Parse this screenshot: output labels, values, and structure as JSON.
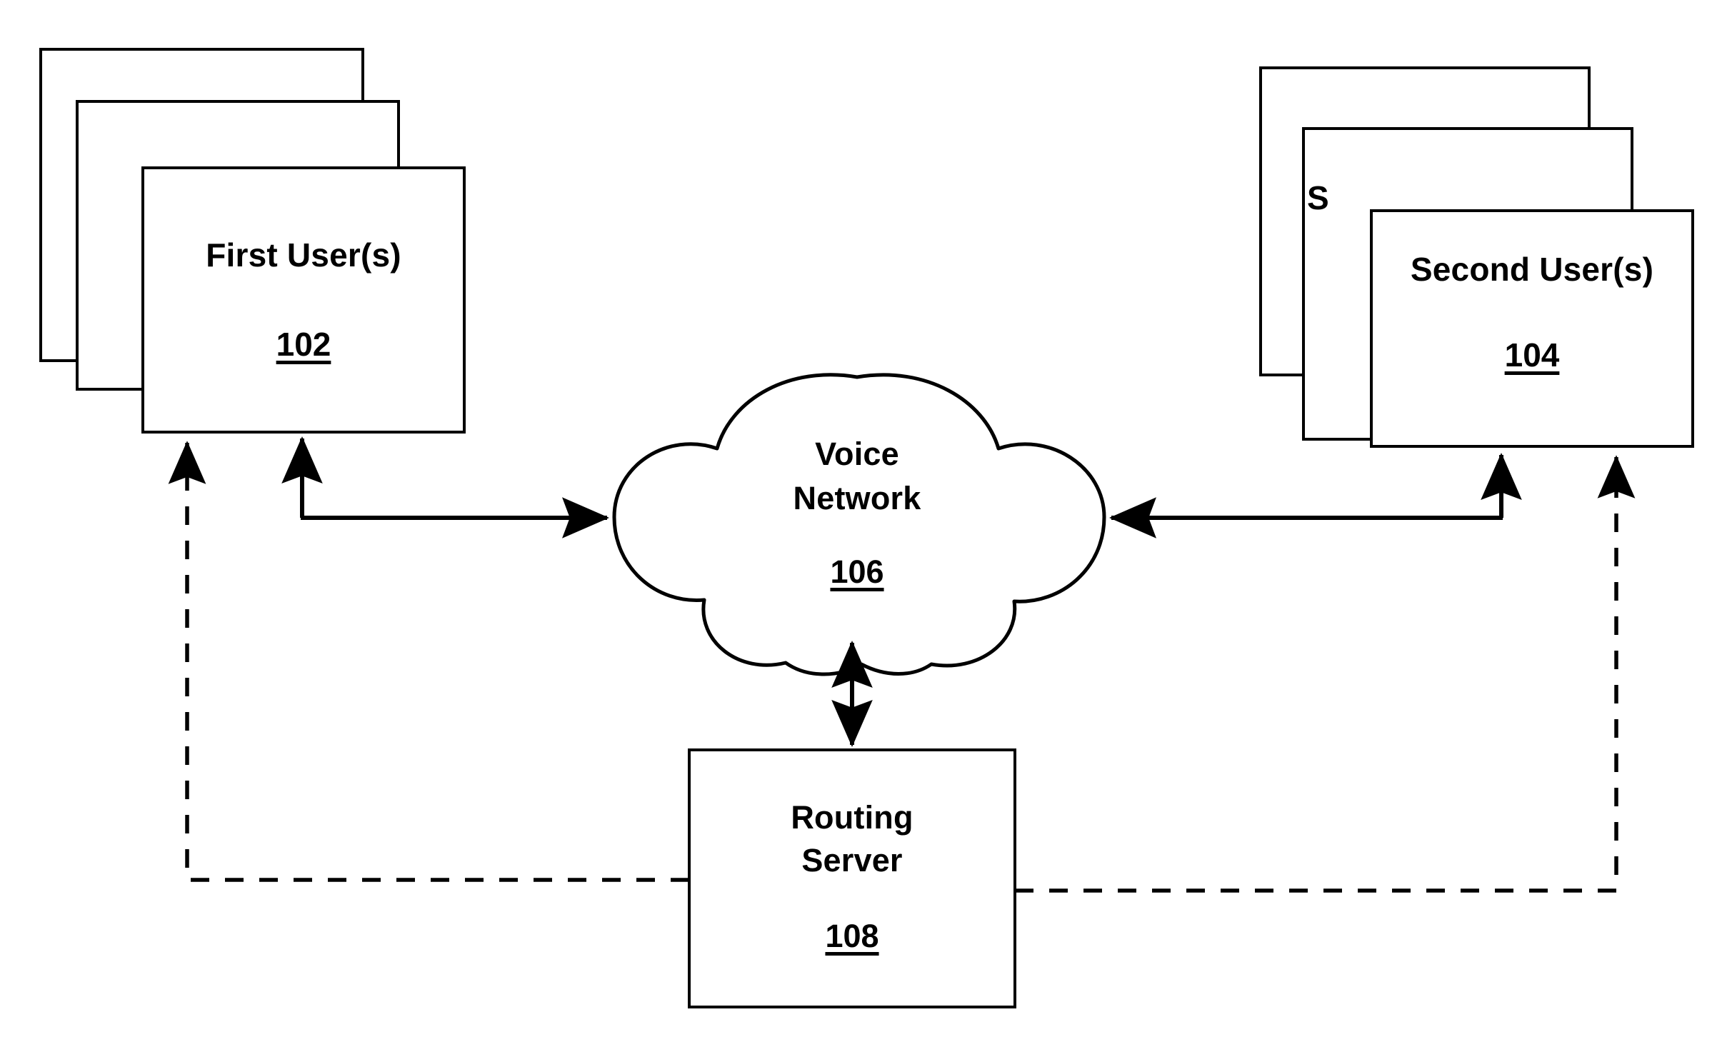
{
  "figure": {
    "type": "patent-block-diagram",
    "background_color": "#ffffff",
    "line_color": "#000000"
  },
  "nodes": {
    "first_user": {
      "title": "First User(s)",
      "ref": "102",
      "stacked_copies": 3,
      "shape": "rectangle"
    },
    "second_user": {
      "title": "Second User(s)",
      "ref": "104",
      "ghost_title": "S",
      "stacked_copies": 3,
      "shape": "rectangle"
    },
    "voice_network": {
      "title": "Voice\nNetwork",
      "title_line1": "Voice",
      "title_line2": "Network",
      "ref": "106",
      "shape": "cloud"
    },
    "routing_server": {
      "title": "Routing\nServer",
      "title_line1": "Routing",
      "title_line2": "Server",
      "ref": "108",
      "shape": "rectangle"
    }
  },
  "connections": [
    {
      "id": "first-user-to-voice-network",
      "from": "first_user",
      "to": "voice_network",
      "style": "solid",
      "arrow": "both-ends",
      "description": "solid bidirectional link between First User(s) and Voice Network"
    },
    {
      "id": "second-user-to-voice-network",
      "from": "second_user",
      "to": "voice_network",
      "style": "solid",
      "arrow": "both-ends",
      "description": "solid bidirectional link between Second User(s) and Voice Network"
    },
    {
      "id": "routing-server-to-voice-network",
      "from": "routing_server",
      "to": "voice_network",
      "style": "solid",
      "arrow": "double",
      "description": "vertical double-headed arrow between Routing Server and Voice Network"
    },
    {
      "id": "routing-server-to-first-user",
      "from": "routing_server",
      "to": "first_user",
      "style": "dashed",
      "arrow": "end",
      "description": "dashed signalling path from Routing Server to First User(s)"
    },
    {
      "id": "routing-server-to-second-user",
      "from": "routing_server",
      "to": "second_user",
      "style": "dashed",
      "arrow": "end",
      "description": "dashed signalling path from Routing Server to Second User(s)"
    }
  ]
}
